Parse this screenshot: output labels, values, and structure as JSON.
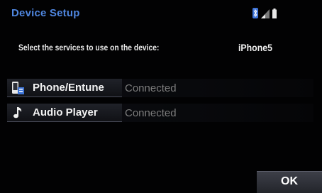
{
  "header": {
    "title": "Device Setup",
    "status_icons": [
      "bluetooth-icon",
      "signal-strength-icon",
      "battery-icon"
    ]
  },
  "instruction": "Select the services to use on the device:",
  "device": {
    "name": "iPhone5"
  },
  "services": [
    {
      "label": "Phone/Entune",
      "status": "Connected",
      "icon": "phone-icon"
    },
    {
      "label": "Audio Player",
      "status": "Connected",
      "icon": "music-note-icon"
    }
  ],
  "footer": {
    "ok_label": "OK"
  },
  "colors": {
    "background": "#020203",
    "title": "#4f86df",
    "text": "#f2f2f2",
    "status_text": "#7d7d7d",
    "button": "#2a2c33"
  }
}
